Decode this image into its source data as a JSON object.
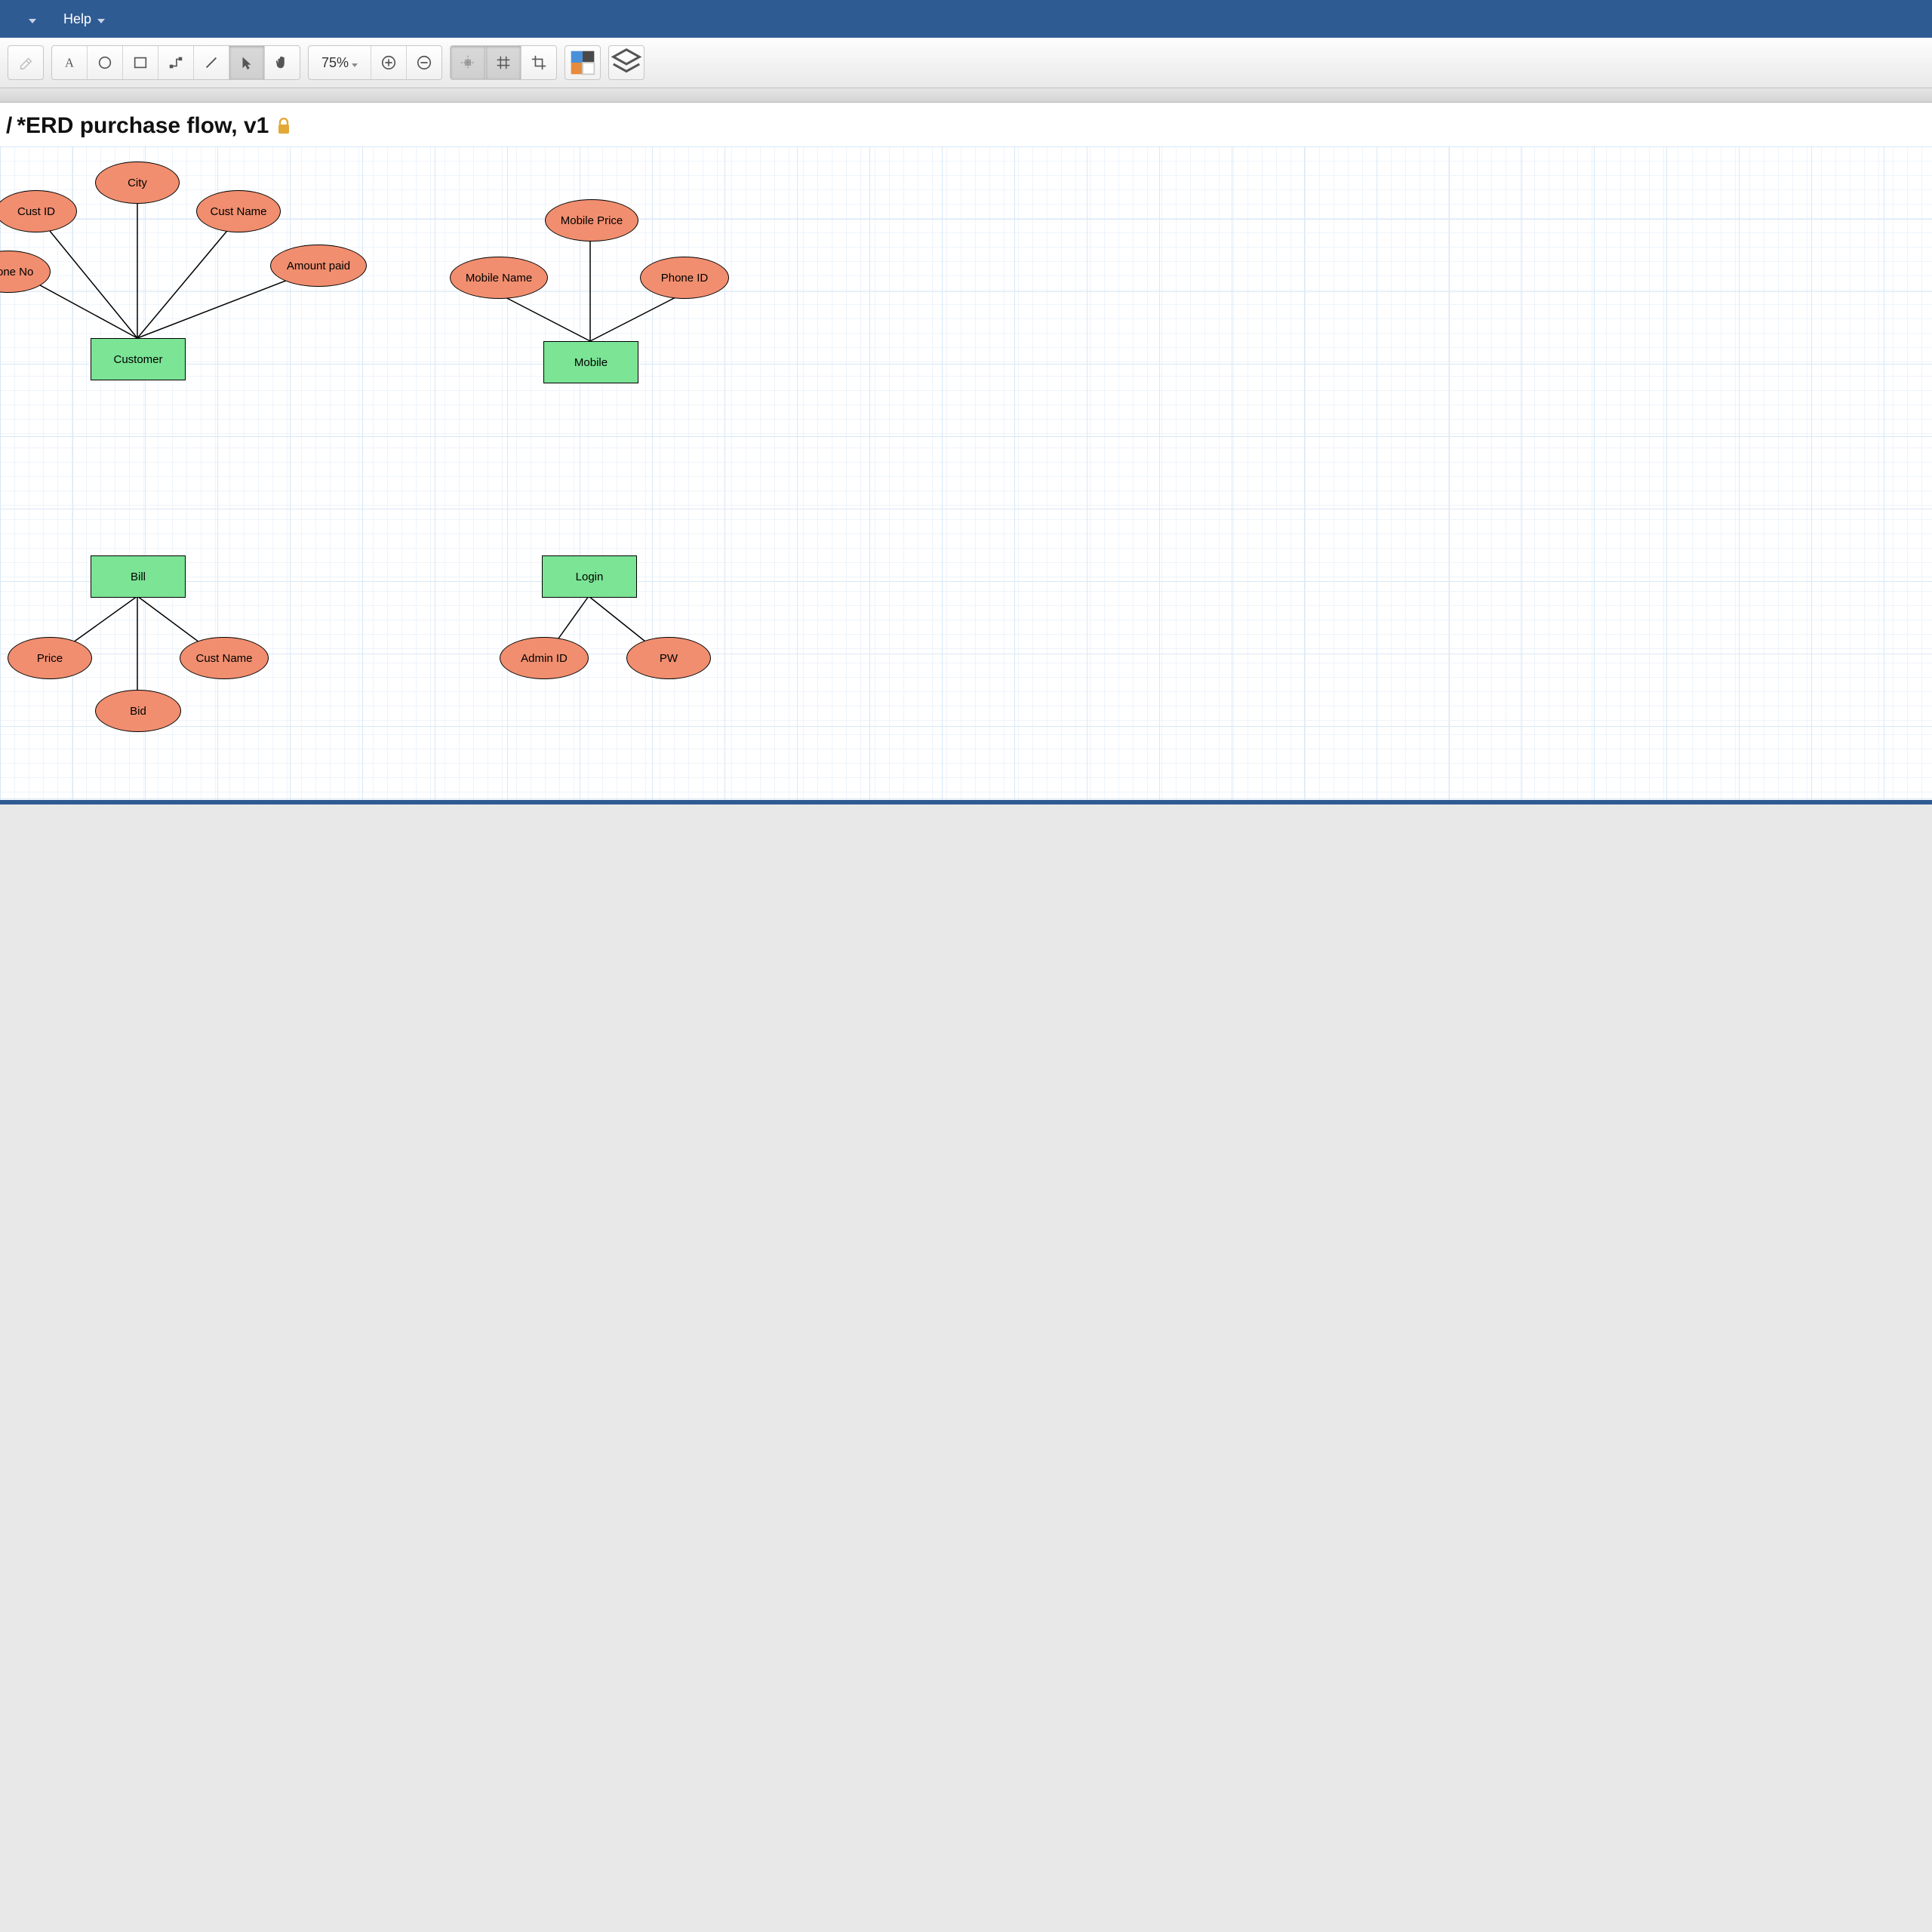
{
  "menubar": {
    "help_label": "Help"
  },
  "toolbar": {
    "zoom_label": "75%"
  },
  "doc": {
    "breadcrumb_prefix": "/ ",
    "title": "*ERD purchase flow, v1"
  },
  "colors": {
    "entity_fill": "#7be495",
    "attribute_fill": "#f08e6f",
    "menubar_bg": "#2f5b93"
  },
  "erd": {
    "entities": {
      "customer": "Customer",
      "mobile": "Mobile",
      "bill": "Bill",
      "login": "Login"
    },
    "attributes": {
      "phone_no": "Phone No",
      "cust_id": "Cust ID",
      "city": "City",
      "cust_name": "Cust Name",
      "amount_paid": "Amount paid",
      "mobile_name": "Mobile Name",
      "mobile_price": "Mobile Price",
      "phone_id": "Phone ID",
      "price": "Price",
      "bid": "Bid",
      "bill_cust_name": "Cust Name",
      "admin_id": "Admin ID",
      "pw": "PW"
    }
  }
}
